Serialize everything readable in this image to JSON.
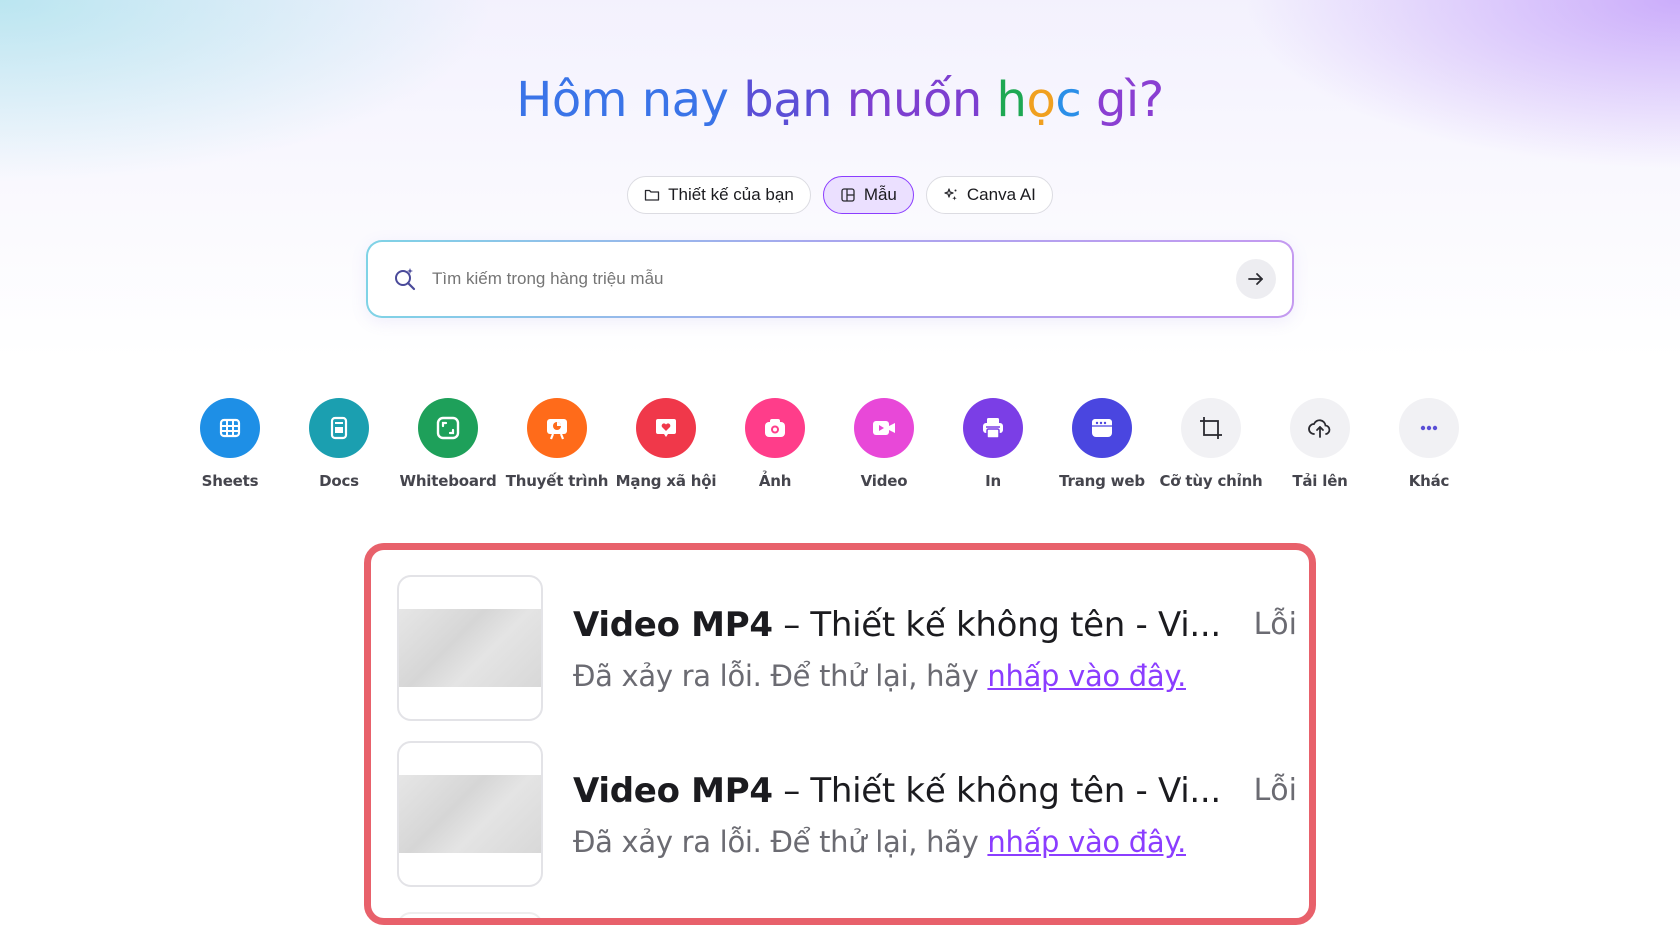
{
  "headline": {
    "part1": "Hôm nay ",
    "part2": "bạn ",
    "part3": "muốn ",
    "h": "h",
    "o": "ọ",
    "c": "c",
    "end": " gì?"
  },
  "tabs": [
    {
      "label": "Thiết kế của bạn",
      "icon": "folder-icon",
      "active": false
    },
    {
      "label": "Mẫu",
      "icon": "template-icon",
      "active": true
    },
    {
      "label": "Canva AI",
      "icon": "sparkle-icon",
      "active": false
    }
  ],
  "search": {
    "placeholder": "Tìm kiếm trong hàng triệu mẫu",
    "icon": "magic-search-icon",
    "submit_icon": "arrow-right-icon"
  },
  "shortcuts": [
    {
      "label": "Sheets",
      "icon": "sheets-icon",
      "color": "#1e8fe6"
    },
    {
      "label": "Docs",
      "icon": "docs-icon",
      "color": "#1b9fb0"
    },
    {
      "label": "Whiteboard",
      "icon": "whiteboard-icon",
      "color": "#1ea05a"
    },
    {
      "label": "Thuyết trình",
      "icon": "presentation-icon",
      "color": "#ff6b1a"
    },
    {
      "label": "Mạng xã hội",
      "icon": "social-heart-icon",
      "color": "#f0384a"
    },
    {
      "label": "Ảnh",
      "icon": "camera-icon",
      "color": "#ff3d8a"
    },
    {
      "label": "Video",
      "icon": "video-icon",
      "color": "#e848d8"
    },
    {
      "label": "In",
      "icon": "printer-icon",
      "color": "#7b3ee6"
    },
    {
      "label": "Trang web",
      "icon": "website-icon",
      "color": "#4a46e0"
    },
    {
      "label": "Cỡ tùy chỉnh",
      "icon": "custom-size-icon",
      "color": "#f1f1f4"
    },
    {
      "label": "Tải lên",
      "icon": "cloud-upload-icon",
      "color": "#f1f1f4"
    },
    {
      "label": "Khác",
      "icon": "more-icon",
      "color": "#f1f1f4"
    }
  ],
  "errors": [
    {
      "title_bold": "Video MP4",
      "title_rest": " – Thiết kế không tên - Vi...",
      "status": "Lỗi",
      "message": "Đã xảy ra lỗi. Để thử lại, hãy ",
      "link": "nhấp vào đây."
    },
    {
      "title_bold": "Video MP4",
      "title_rest": " – Thiết kế không tên - Vi...",
      "status": "Lỗi",
      "message": "Đã xảy ra lỗi. Để thử lại, hãy ",
      "link": "nhấp vào đây."
    }
  ],
  "colors": {
    "accent": "#8b3dff",
    "error_border": "#e8616b"
  }
}
